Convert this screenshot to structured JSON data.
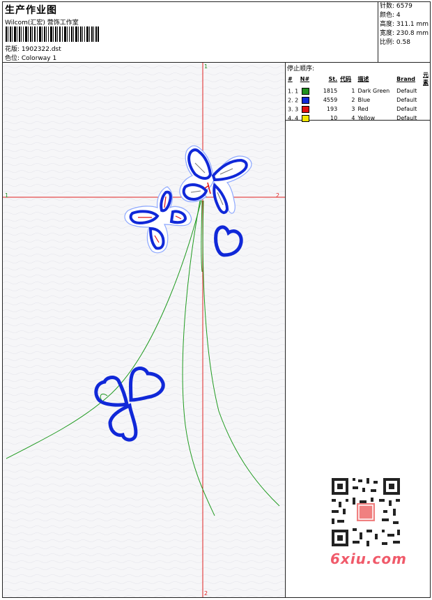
{
  "header": {
    "title": "生产作业图",
    "company": "Wilcom(汇宏) 营饰工作室",
    "design_label": "花版: 1902322.dst",
    "colorway_label": "色位: Colorway 1"
  },
  "info": {
    "stitches": "针数: 6579",
    "colors": "颜色: 4",
    "height": "高度: 311.1 mm",
    "width": "宽度: 230.8 mm",
    "scale": "比例: 0.58"
  },
  "stops": {
    "caption": "停止顺序:",
    "headers": [
      "#",
      "N#",
      "St.",
      "代码",
      "描述",
      "Brand",
      "元素"
    ],
    "rows": [
      {
        "n": "1. 1",
        "color": "#1f8f1f",
        "st": "1815",
        "code": "1",
        "desc": "Dark Green",
        "brand": "Default"
      },
      {
        "n": "2. 2",
        "color": "#1028d8",
        "st": "4559",
        "code": "2",
        "desc": "Blue",
        "brand": "Default"
      },
      {
        "n": "3. 3",
        "color": "#e01010",
        "st": "193",
        "code": "3",
        "desc": "Red",
        "brand": "Default"
      },
      {
        "n": "4. 4",
        "color": "#f2e600",
        "st": "10",
        "code": "4",
        "desc": "Yellow",
        "brand": "Default"
      }
    ]
  },
  "axis": {
    "top": "1",
    "left": "1",
    "right": "2",
    "bottom": "2"
  },
  "watermark": "6xiu.com"
}
